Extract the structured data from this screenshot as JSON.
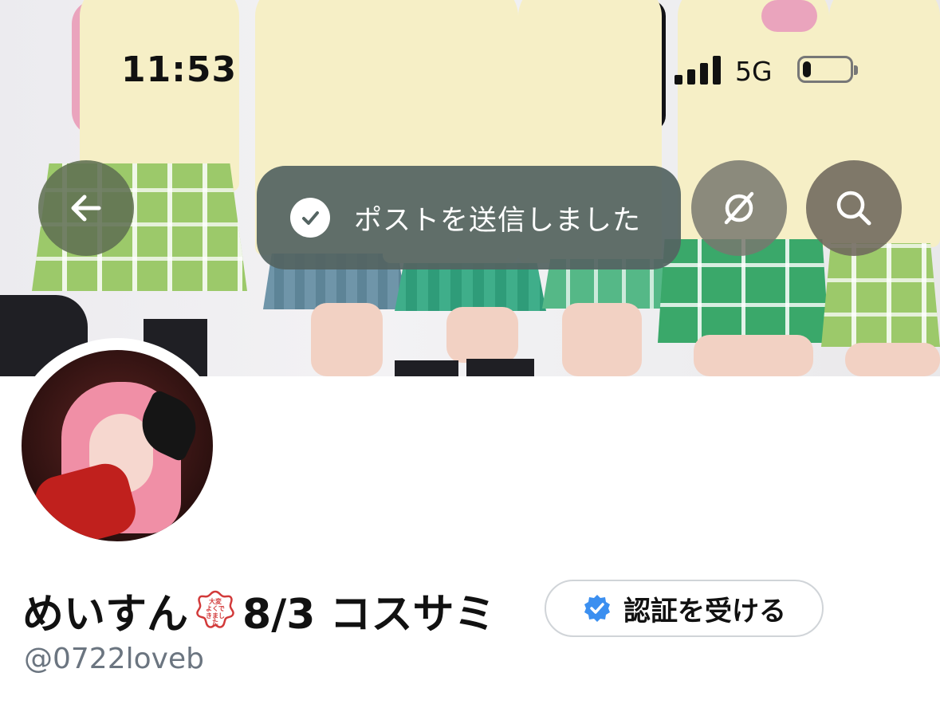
{
  "status_bar": {
    "time": "11:53",
    "network": "5G",
    "signal_bars": 4,
    "battery_fraction": 0.18
  },
  "header": {
    "back_icon": "arrow-left-icon",
    "hide_icon": "eye-slash-icon",
    "search_icon": "search-icon"
  },
  "toast": {
    "icon": "check-circle-icon",
    "message": "ポストを送信しました"
  },
  "profile": {
    "name_prefix": "めいすん",
    "seal_lines": [
      "大変",
      "よくで",
      "きまし",
      "た"
    ],
    "name_suffix": "8/3 コスサミ",
    "handle": "@0722loveb"
  },
  "verify_button": {
    "icon": "verified-badge-icon",
    "label": "認証を受ける"
  },
  "colors": {
    "toast_bg": "#546462",
    "verified_blue": "#3b8ff0",
    "handle_gray": "#6b7580"
  }
}
